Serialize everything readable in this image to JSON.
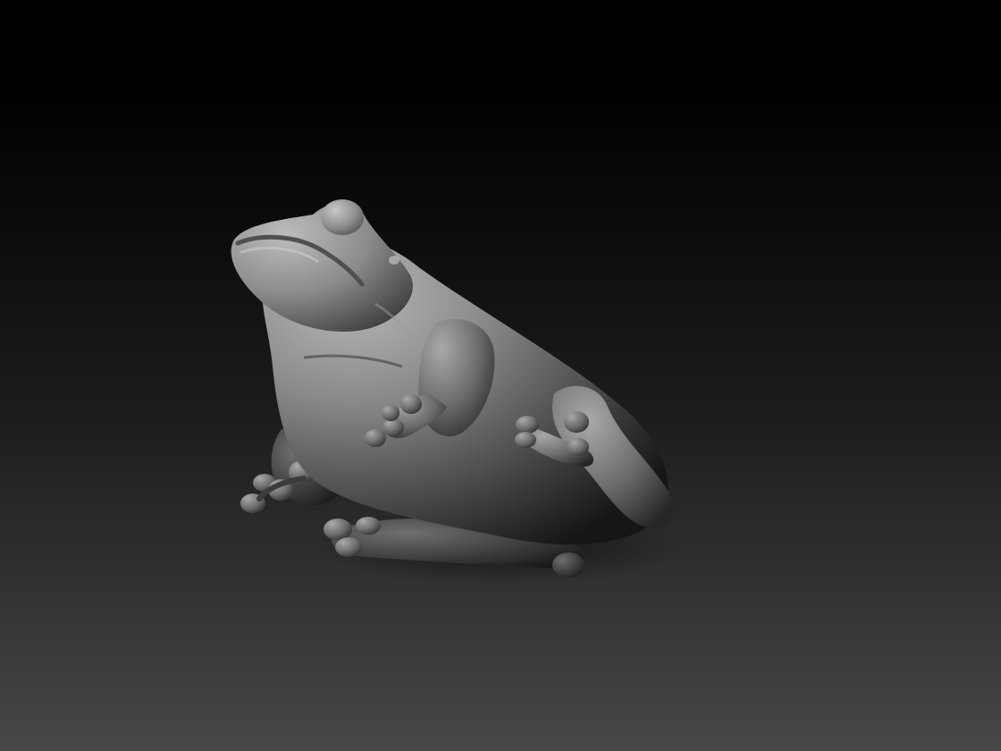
{
  "viewport": {
    "background_top": "#000000",
    "background_mid": "#1c1c1c",
    "background_bottom": "#474747"
  },
  "model": {
    "subject": "frog sculpt",
    "material_light": "#b8b8b8",
    "material_mid": "#6e6e6e",
    "material_dark": "#1e1e1e"
  }
}
